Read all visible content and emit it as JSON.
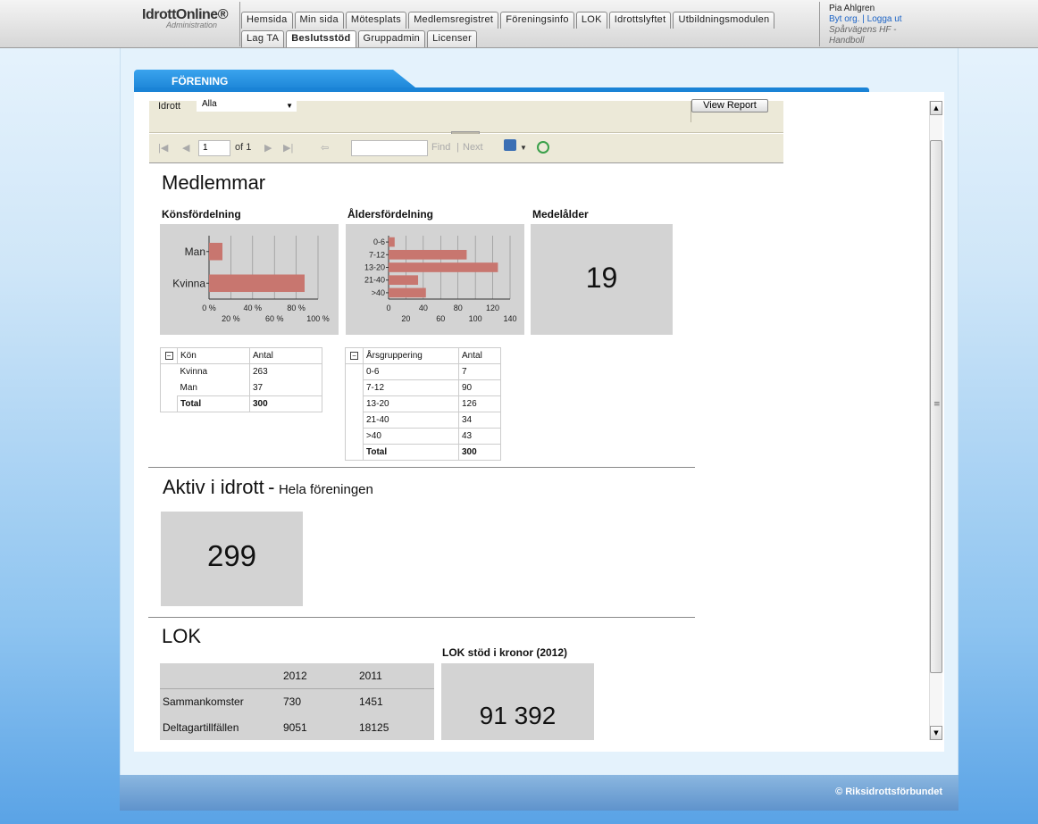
{
  "header": {
    "logo_main": "IdrottOnline®",
    "logo_sub": "Administration",
    "tabs_row1": [
      "Hemsida",
      "Min sida",
      "Mötesplats",
      "Medlemsregistret",
      "Föreningsinfo",
      "LOK",
      "Idrottslyftet",
      "Utbildningsmodulen"
    ],
    "tabs_row2": [
      "Lag TA",
      "Beslutsstöd",
      "Gruppadmin",
      "Licenser"
    ],
    "active_tab": "Beslutsstöd",
    "user_name": "Pia Ahlgren",
    "switch_org": "Byt org.",
    "logout": "Logga ut",
    "org_name": "Spårvägens HF - Handboll"
  },
  "section_title": "FÖRENING",
  "params": {
    "idrott_label": "Idrott",
    "idrott_value": "Alla",
    "view_report": "View Report"
  },
  "toolbar": {
    "page_value": "1",
    "of_pages": "of 1",
    "find": "Find",
    "next": "Next",
    "separator": "|"
  },
  "report": {
    "members_title": "Medlemmar",
    "gender_chart_title": "Könsfördelning",
    "age_chart_title": "Åldersfördelning",
    "mean_age_title": "Medelålder",
    "mean_age_value": "19",
    "gender_table": {
      "headers": [
        "Kön",
        "Antal"
      ],
      "rows": [
        [
          "Kvinna",
          "263"
        ],
        [
          "Man",
          "37"
        ]
      ],
      "total": [
        "Total",
        "300"
      ]
    },
    "age_table": {
      "headers": [
        "Årsgruppering",
        "Antal"
      ],
      "rows": [
        [
          "0-6",
          "7"
        ],
        [
          "7-12",
          "90"
        ],
        [
          "13-20",
          "126"
        ],
        [
          "21-40",
          "34"
        ],
        [
          ">40",
          "43"
        ]
      ],
      "total": [
        "Total",
        "300"
      ]
    },
    "active_title": "Aktiv i idrott",
    "active_dash": "-",
    "active_sub": "Hela föreningen",
    "active_value": "299",
    "lok_title": "LOK",
    "lok_table": {
      "years": [
        "2012",
        "2011"
      ],
      "rows": [
        [
          "Sammankomster",
          "730",
          "1451"
        ],
        [
          "Deltagartillfällen",
          "9051",
          "18125"
        ]
      ]
    },
    "lok_support_title": "LOK stöd i kronor (2012)",
    "lok_support_value": "91 392"
  },
  "footer": "© Riksidrottsförbundet",
  "colors": {
    "bar": "#c8766f",
    "tab_blue": "#1a83d6",
    "box_gray": "#d3d3d3"
  },
  "chart_data": [
    {
      "type": "bar",
      "orientation": "horizontal",
      "categories": [
        "Man",
        "Kvinna"
      ],
      "values": [
        12.3,
        87.7
      ],
      "xlim": [
        0,
        100
      ],
      "x_ticks_top": [
        "0 %",
        "40 %",
        "80 %"
      ],
      "x_ticks_bottom": [
        "20 %",
        "60 %",
        "100 %"
      ]
    },
    {
      "type": "bar",
      "orientation": "horizontal",
      "categories": [
        "0-6",
        "7-12",
        "13-20",
        "21-40",
        ">40"
      ],
      "values": [
        7,
        90,
        126,
        34,
        43
      ],
      "xlim": [
        0,
        140
      ],
      "x_ticks_top": [
        "0",
        "40",
        "80",
        "120"
      ],
      "x_ticks_bottom": [
        "20",
        "60",
        "100",
        "140"
      ]
    }
  ]
}
